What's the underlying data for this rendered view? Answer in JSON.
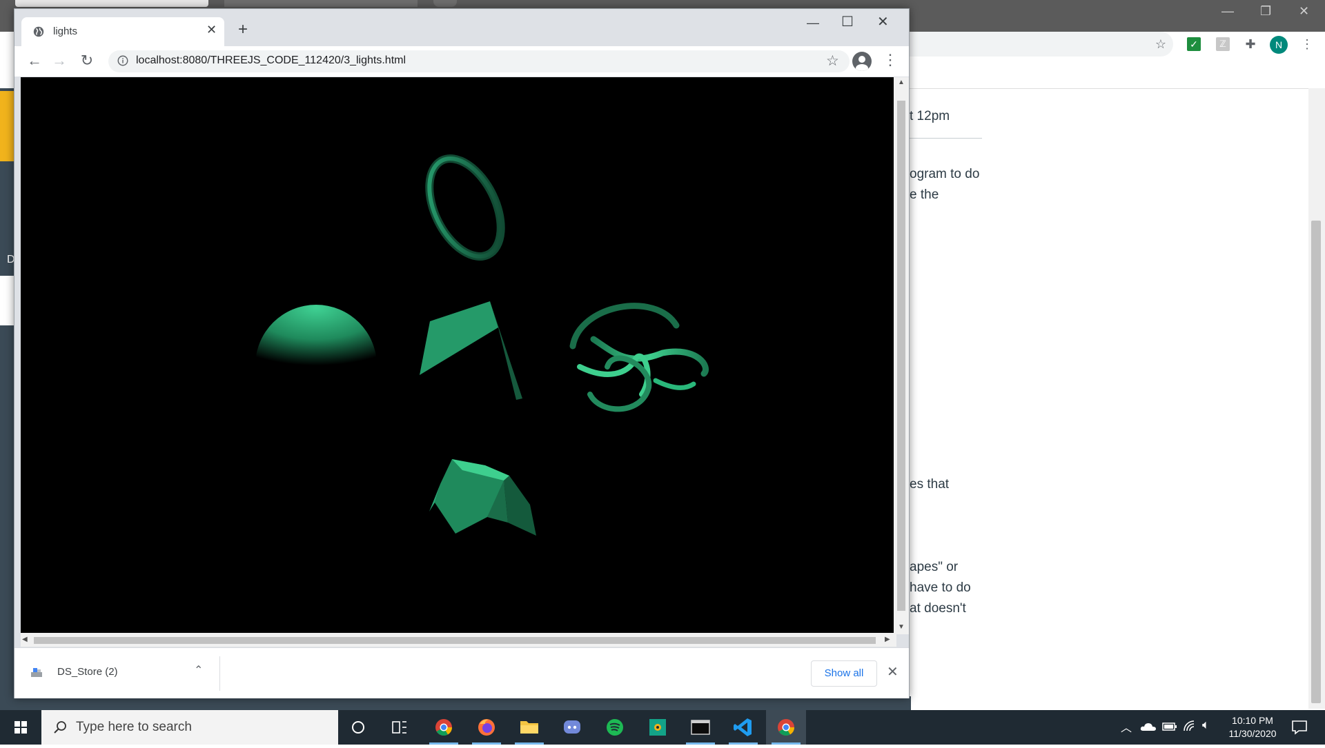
{
  "background_window": {
    "page_lines": [
      "t 12pm",
      "ogram to do",
      "e the",
      "es that",
      "apes\" or",
      "have to do",
      "at doesn't"
    ],
    "left_letter": "D",
    "profile_initial": "N"
  },
  "tab": {
    "title": "lights"
  },
  "address_bar": {
    "url": "localhost:8080/THREEJS_CODE_112420/3_lights.html"
  },
  "downloads": {
    "file_name": "DS_Store (2)",
    "show_all_label": "Show all"
  },
  "taskbar": {
    "search_placeholder": "Type here to search",
    "time": "10:10 PM",
    "date": "11/30/2020",
    "pinned_apps": [
      "chrome",
      "firefox",
      "file-explorer",
      "discord",
      "spotify",
      "greenshot",
      "terminal",
      "vscode",
      "chrome-active"
    ]
  },
  "colors": {
    "mesh_green": "#3ecf8e",
    "canvas_bg": "#000000",
    "taskbar_bg": "#1f2a33"
  }
}
